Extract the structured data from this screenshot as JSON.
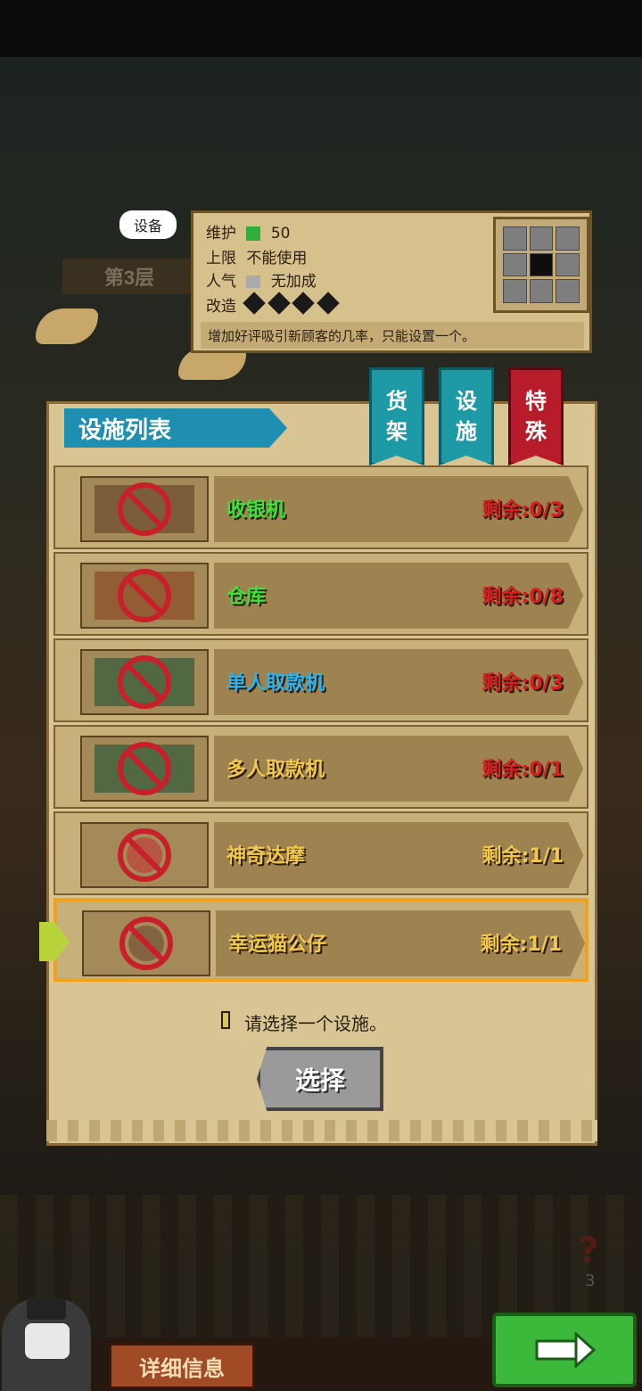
{
  "scene": {
    "floor_label": "第3层",
    "device_tag": "设备"
  },
  "info_card": {
    "maintenance_label": "维护",
    "maintenance_value": "50",
    "limit_label": "上限",
    "limit_value": "不能使用",
    "popularity_label": "人气",
    "popularity_value": "无加成",
    "upgrade_label": "改造",
    "upgrade_level": 4,
    "description": "增加好评吸引新顾客的几率，只能设置一个。"
  },
  "panel": {
    "title": "设施列表",
    "tabs": [
      {
        "line1": "货",
        "line2": "架",
        "color": "#1e9aa6",
        "active": false
      },
      {
        "line1": "设",
        "line2": "施",
        "color": "#1e9aa6",
        "active": false
      },
      {
        "line1": "特",
        "line2": "殊",
        "color": "#b81c2a",
        "active": true
      }
    ],
    "items": [
      {
        "name": "收银机",
        "remain": "剩余:0/3",
        "name_color": "#3be03b",
        "remain_color": "#d81e1e",
        "selected": false
      },
      {
        "name": "仓库",
        "remain": "剩余:0/8",
        "name_color": "#3be03b",
        "remain_color": "#d81e1e",
        "selected": false
      },
      {
        "name": "单人取款机",
        "remain": "剩余:0/3",
        "name_color": "#2bb5f0",
        "remain_color": "#d81e1e",
        "selected": false
      },
      {
        "name": "多人取款机",
        "remain": "剩余:0/1",
        "name_color": "#f0c84a",
        "remain_color": "#d81e1e",
        "selected": false
      },
      {
        "name": "神奇达摩",
        "remain": "剩余:1/1",
        "name_color": "#f0c84a",
        "remain_color": "#f0c84a",
        "selected": false
      },
      {
        "name": "幸运猫公仔",
        "remain": "剩余:1/1",
        "name_color": "#f0c84a",
        "remain_color": "#f0c84a",
        "selected": true
      }
    ],
    "hint": "请选择一个设施。",
    "select_button": "选择"
  },
  "bottom": {
    "detail_button": "详细信息",
    "help_count": "3"
  }
}
